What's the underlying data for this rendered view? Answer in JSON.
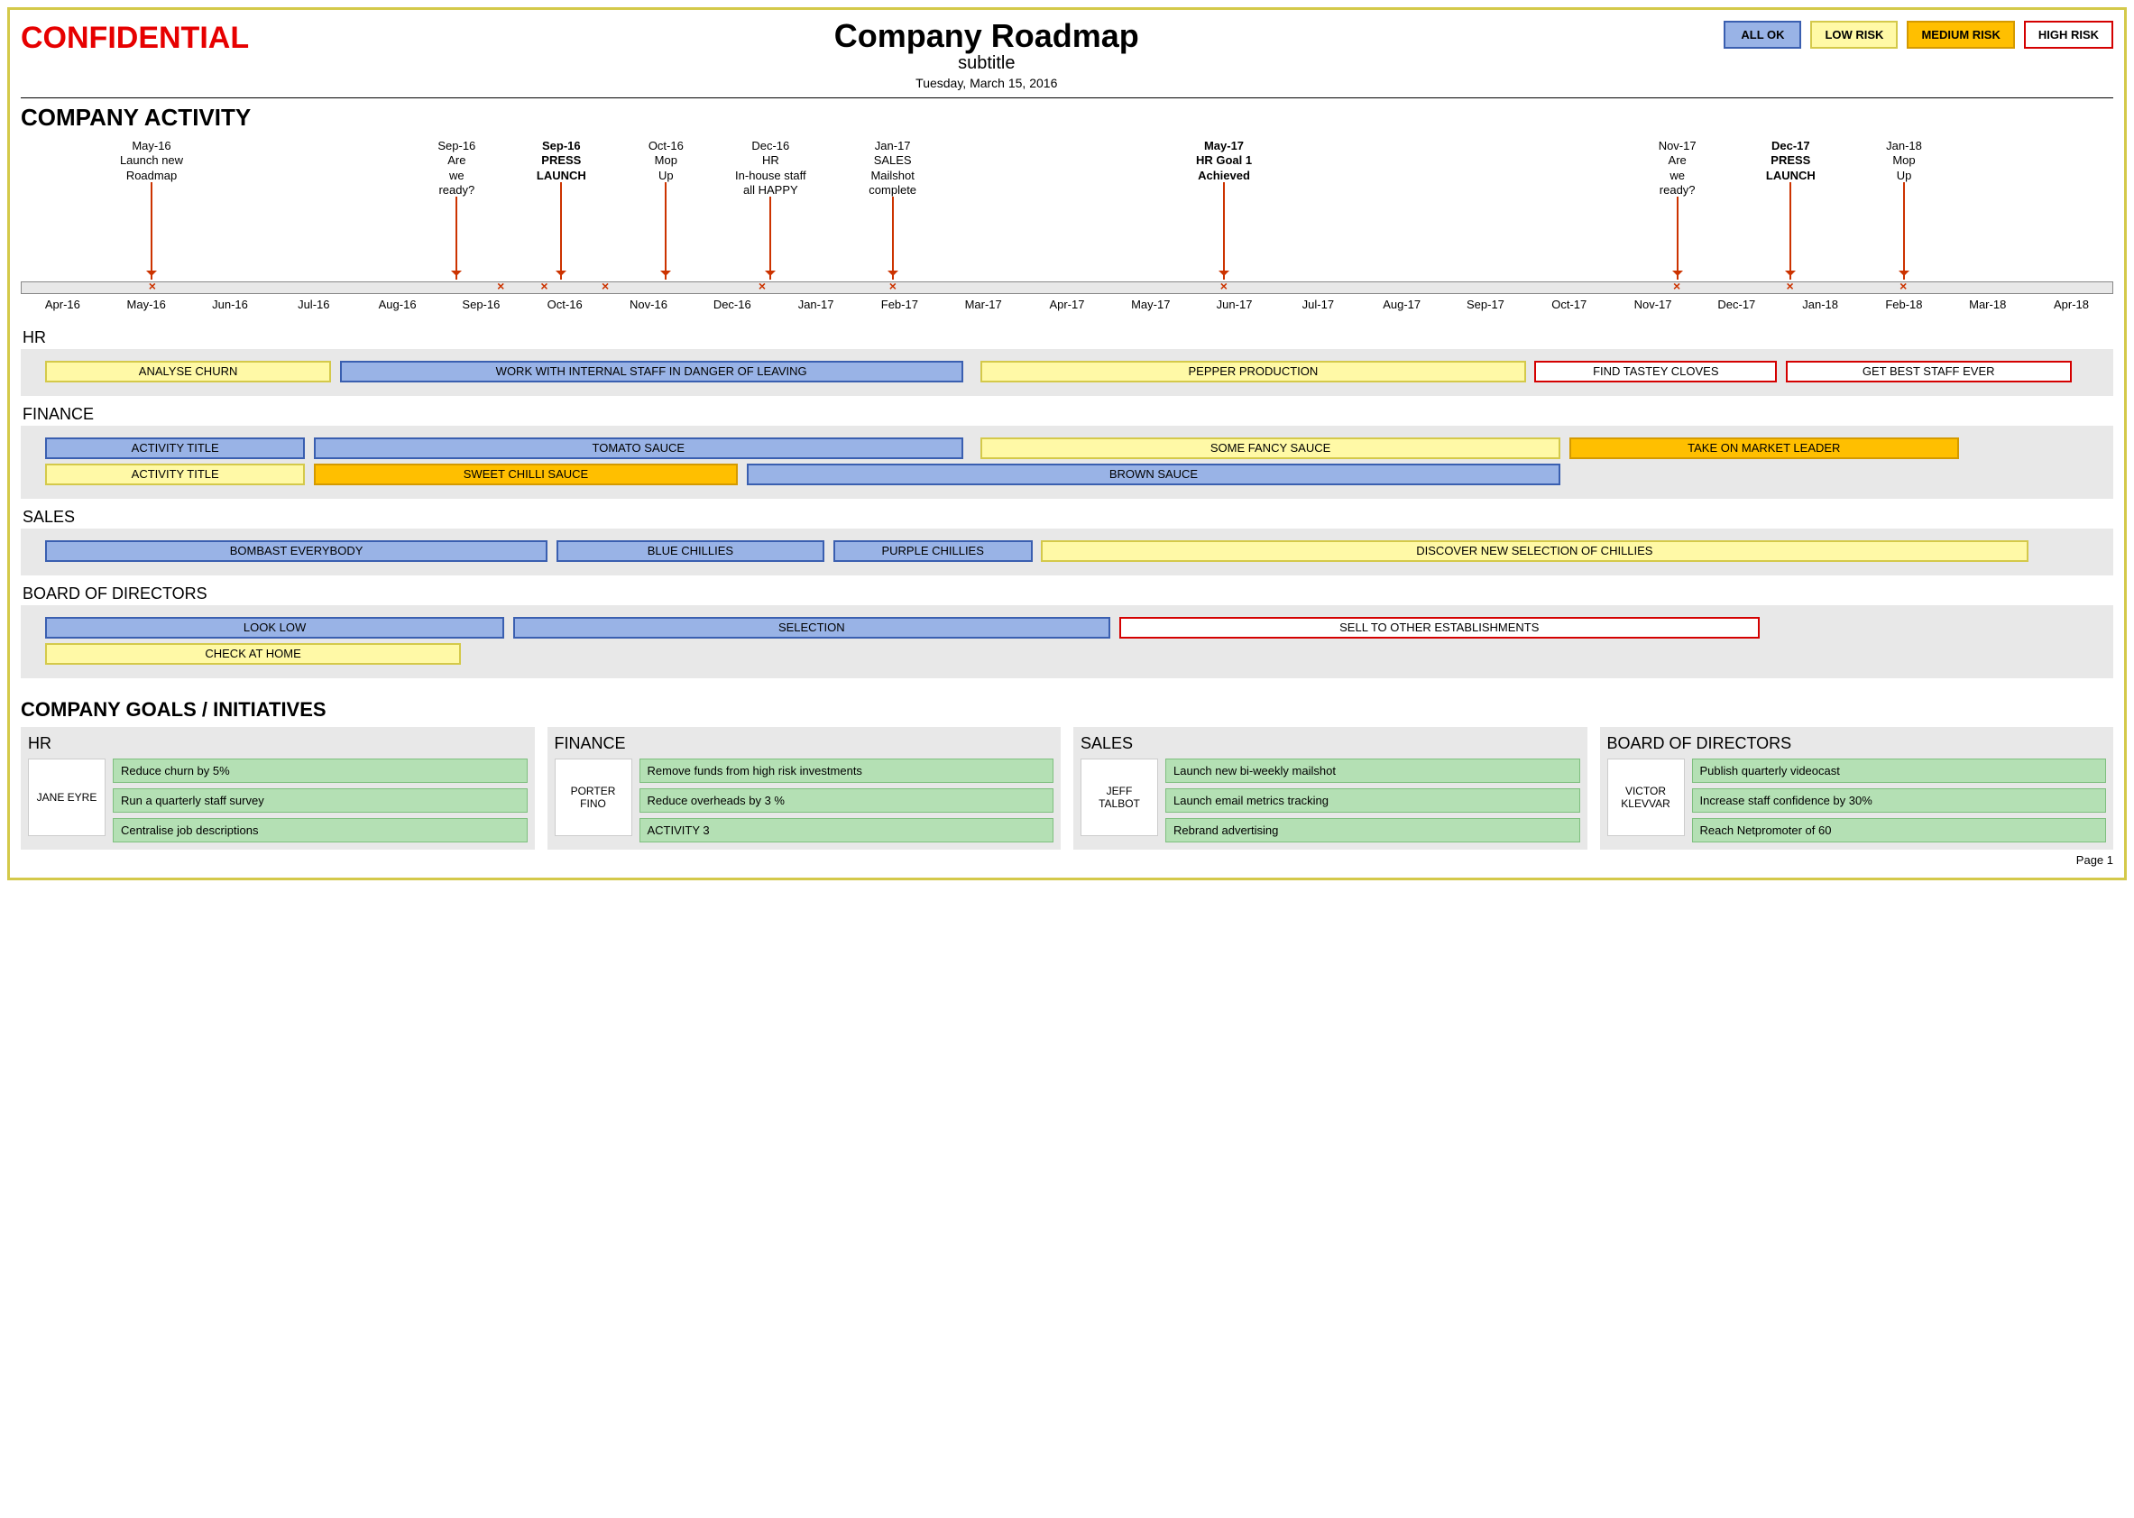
{
  "header": {
    "confidential": "CONFIDENTIAL",
    "title": "Company Roadmap",
    "subtitle": "subtitle",
    "date": "Tuesday, March 15, 2016"
  },
  "legend": {
    "ok": "ALL OK",
    "low": "LOW RISK",
    "med": "MEDIUM RISK",
    "high": "HIGH RISK"
  },
  "section_activity": "COMPANY ACTIVITY",
  "timeline": {
    "months": [
      "Apr-16",
      "May-16",
      "Jun-16",
      "Jul-16",
      "Aug-16",
      "Sep-16",
      "Oct-16",
      "Nov-16",
      "Dec-16",
      "Jan-17",
      "Feb-17",
      "Mar-17",
      "Apr-17",
      "May-17",
      "Jun-17",
      "Jul-17",
      "Aug-17",
      "Sep-17",
      "Oct-17",
      "Nov-17",
      "Dec-17",
      "Jan-18",
      "Feb-18",
      "Mar-18",
      "Apr-18"
    ],
    "milestones": [
      {
        "pos": 1.5,
        "date": "May-16",
        "text": "Launch new\nRoadmap",
        "bold": false,
        "x": 1.5
      },
      {
        "pos": 5.0,
        "date": "Sep-16",
        "text": "Are\nwe\nready?",
        "bold": false,
        "x": 5.5
      },
      {
        "pos": 6.2,
        "date": "Sep-16",
        "text": "PRESS\nLAUNCH",
        "bold": true,
        "x": 6.0
      },
      {
        "pos": 7.4,
        "date": "Oct-16",
        "text": "Mop\nUp",
        "bold": false,
        "x": 6.7
      },
      {
        "pos": 8.6,
        "date": "Dec-16",
        "text": "HR\nIn-house staff\nall HAPPY",
        "bold": false,
        "x": 8.5
      },
      {
        "pos": 10.0,
        "date": "Jan-17",
        "text": "SALES\nMailshot\ncomplete",
        "bold": false,
        "x": 10.0
      },
      {
        "pos": 13.8,
        "date": "May-17",
        "text": "HR Goal 1\nAchieved",
        "bold": true,
        "x": 13.8
      },
      {
        "pos": 19.0,
        "date": "Nov-17",
        "text": "Are\nwe\nready?",
        "bold": false,
        "x": 19.0
      },
      {
        "pos": 20.3,
        "date": "Dec-17",
        "text": "PRESS\nLAUNCH",
        "bold": true,
        "x": 20.3
      },
      {
        "pos": 21.6,
        "date": "Jan-18",
        "text": "Mop\nUp",
        "bold": false,
        "x": 21.6
      }
    ]
  },
  "lanes": [
    {
      "name": "HR",
      "rows": [
        [
          {
            "label": "ANALYSE CHURN",
            "start": 0.2,
            "end": 3.5,
            "color": "yellow"
          },
          {
            "label": "WORK WITH INTERNAL STAFF IN DANGER OF LEAVING",
            "start": 3.6,
            "end": 10.8,
            "color": "blue"
          },
          {
            "label": "PEPPER PRODUCTION",
            "start": 11.0,
            "end": 17.3,
            "color": "yellow"
          },
          {
            "label": "FIND TASTEY CLOVES",
            "start": 17.4,
            "end": 20.2,
            "color": "red"
          },
          {
            "label": "GET BEST STAFF EVER",
            "start": 20.3,
            "end": 23.6,
            "color": "red"
          }
        ]
      ]
    },
    {
      "name": "FINANCE",
      "rows": [
        [
          {
            "label": "ACTIVITY TITLE",
            "start": 0.2,
            "end": 3.2,
            "color": "blue"
          },
          {
            "label": "TOMATO SAUCE",
            "start": 3.3,
            "end": 10.8,
            "color": "blue"
          },
          {
            "label": "SOME FANCY SAUCE",
            "start": 11.0,
            "end": 17.7,
            "color": "yellow"
          },
          {
            "label": "TAKE ON MARKET LEADER",
            "start": 17.8,
            "end": 22.3,
            "color": "orange"
          }
        ],
        [
          {
            "label": "ACTIVITY TITLE",
            "start": 0.2,
            "end": 3.2,
            "color": "yellow"
          },
          {
            "label": "SWEET CHILLI SAUCE",
            "start": 3.3,
            "end": 8.2,
            "color": "orange"
          },
          {
            "label": "BROWN SAUCE",
            "start": 8.3,
            "end": 17.7,
            "color": "blue"
          }
        ]
      ]
    },
    {
      "name": "SALES",
      "rows": [
        [
          {
            "label": "BOMBAST EVERYBODY",
            "start": 0.2,
            "end": 6.0,
            "color": "blue"
          },
          {
            "label": "BLUE CHILLIES",
            "start": 6.1,
            "end": 9.2,
            "color": "blue"
          },
          {
            "label": "PURPLE CHILLIES",
            "start": 9.3,
            "end": 11.6,
            "color": "blue"
          },
          {
            "label": "DISCOVER NEW SELECTION OF CHILLIES",
            "start": 11.7,
            "end": 23.1,
            "color": "yellow"
          }
        ]
      ]
    },
    {
      "name": "BOARD OF DIRECTORS",
      "rows": [
        [
          {
            "label": "LOOK LOW",
            "start": 0.2,
            "end": 5.5,
            "color": "blue"
          },
          {
            "label": "SELECTION",
            "start": 5.6,
            "end": 12.5,
            "color": "blue"
          },
          {
            "label": "SELL TO OTHER ESTABLISHMENTS",
            "start": 12.6,
            "end": 20.0,
            "color": "red"
          }
        ],
        [
          {
            "label": "CHECK AT HOME",
            "start": 0.2,
            "end": 5.0,
            "color": "yellow"
          }
        ]
      ]
    }
  ],
  "section_goals": "COMPANY GOALS / INITIATIVES",
  "goals": [
    {
      "dept": "HR",
      "person": "JANE EYRE",
      "items": [
        "Reduce churn by 5%",
        "Run a quarterly staff survey",
        "Centralise job descriptions"
      ]
    },
    {
      "dept": "FINANCE",
      "person": "PORTER FINO",
      "items": [
        "Remove funds from high risk investments",
        "Reduce overheads by 3 %",
        "ACTIVITY 3"
      ]
    },
    {
      "dept": "SALES",
      "person": "JEFF TALBOT",
      "items": [
        "Launch new bi-weekly mailshot",
        "Launch email metrics tracking",
        "Rebrand advertising"
      ]
    },
    {
      "dept": "BOARD OF DIRECTORS",
      "person": "VICTOR KLEVVAR",
      "items": [
        "Publish quarterly videocast",
        "Increase staff confidence by 30%",
        "Reach Netpromoter of 60"
      ]
    }
  ],
  "page_num": "Page 1",
  "chart_data": {
    "type": "gantt-roadmap",
    "time_axis": {
      "start": "Apr-16",
      "end": "Apr-18",
      "unit": "month",
      "ticks": [
        "Apr-16",
        "May-16",
        "Jun-16",
        "Jul-16",
        "Aug-16",
        "Sep-16",
        "Oct-16",
        "Nov-16",
        "Dec-16",
        "Jan-17",
        "Feb-17",
        "Mar-17",
        "Apr-17",
        "May-17",
        "Jun-17",
        "Jul-17",
        "Aug-17",
        "Sep-17",
        "Oct-17",
        "Nov-17",
        "Dec-17",
        "Jan-18",
        "Feb-18",
        "Mar-18",
        "Apr-18"
      ]
    },
    "milestones": [
      "May-16 Launch new Roadmap",
      "Sep-16 Are we ready?",
      "Sep-16 PRESS LAUNCH",
      "Oct-16 Mop Up",
      "Dec-16 HR In-house staff all HAPPY",
      "Jan-17 SALES Mailshot complete",
      "May-17 HR Goal 1 Achieved",
      "Nov-17 Are we ready?",
      "Dec-17 PRESS LAUNCH",
      "Jan-18 Mop Up"
    ],
    "risk_legend": {
      "ALL OK": "blue",
      "LOW RISK": "yellow",
      "MEDIUM RISK": "orange",
      "HIGH RISK": "red-outline"
    }
  }
}
